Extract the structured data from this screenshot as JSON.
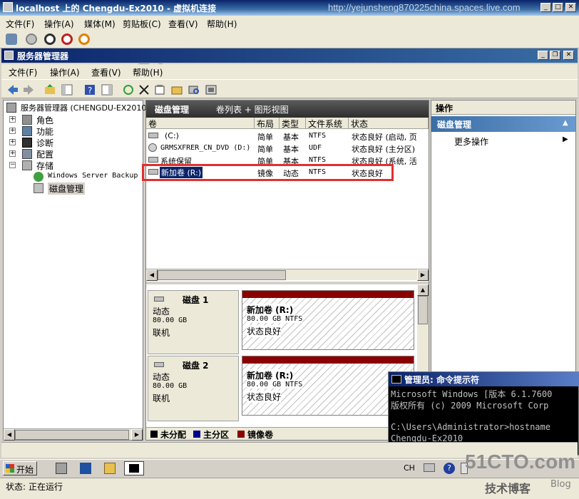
{
  "vm": {
    "title": "localhost 上的 Chengdu-Ex2010 - 虚拟机连接",
    "watermark": "http://yejunsheng870225china.spaces.live.com",
    "menu": [
      "文件(F)",
      "操作(A)",
      "媒体(M)",
      "剪贴板(C)",
      "查看(V)",
      "帮助(H)"
    ],
    "status_label": "状态:",
    "status_value": "正在运行"
  },
  "server_manager": {
    "title": "服务器管理器",
    "menu": [
      "文件(F)",
      "操作(A)",
      "查看(V)",
      "帮助(H)"
    ],
    "tree": {
      "root": "服务器管理器 (CHENGDU-EX2010",
      "items": [
        "角色",
        "功能",
        "诊断",
        "配置",
        "存储"
      ],
      "storage_children": [
        "Windows Server Backup",
        "磁盘管理"
      ]
    }
  },
  "disk_management": {
    "header_title": "磁盘管理",
    "header_views": "卷列表 + 图形视图",
    "columns": [
      "卷",
      "布局",
      "类型",
      "文件系统",
      "状态"
    ],
    "volumes": [
      {
        "name": "(C:)",
        "layout": "简单",
        "type": "基本",
        "fs": "NTFS",
        "status": "状态良好 (启动, 页"
      },
      {
        "name": "GRMSXFRER_CN_DVD (D:)",
        "layout": "简单",
        "type": "基本",
        "fs": "UDF",
        "status": "状态良好 (主分区)"
      },
      {
        "name": "系统保留",
        "layout": "简单",
        "type": "基本",
        "fs": "NTFS",
        "status": "状态良好 (系统, 活"
      },
      {
        "name": "新加卷 (R:)",
        "layout": "镜像",
        "type": "动态",
        "fs": "NTFS",
        "status": "状态良好"
      }
    ],
    "disks": [
      {
        "name": "磁盘 1",
        "kind": "动态",
        "size": "80.00 GB",
        "state": "联机",
        "partition": {
          "name": "新加卷  (R:)",
          "detail": "80.00 GB NTFS",
          "status": "状态良好"
        }
      },
      {
        "name": "磁盘 2",
        "kind": "动态",
        "size": "80.00 GB",
        "state": "联机",
        "partition": {
          "name": "新加卷  (R:)",
          "detail": "80.00 GB NTFS",
          "status": "状态良好"
        }
      }
    ],
    "legend": [
      {
        "label": "未分配",
        "color": "#000000"
      },
      {
        "label": "主分区",
        "color": "#00008b"
      },
      {
        "label": "镜像卷",
        "color": "#8b0000"
      }
    ]
  },
  "actions": {
    "title": "操作",
    "section": "磁盘管理",
    "more": "更多操作"
  },
  "cmd": {
    "title": "管理员: 命令提示符",
    "lines": [
      "Microsoft Windows [版本 6.1.7600",
      "版权所有 (c) 2009 Microsoft Corp",
      "",
      "C:\\Users\\Administrator>hostname",
      "Chengdu-Ex2010"
    ]
  },
  "taskbar": {
    "start": "开始",
    "lang": "CH"
  },
  "branding": {
    "site": "51CTO.com",
    "tagline": "技术博客",
    "blog": "Blog"
  },
  "colors": {
    "mirror": "#8b0000",
    "highlight_box": "#e03030",
    "title_blue": "#0a246a"
  }
}
